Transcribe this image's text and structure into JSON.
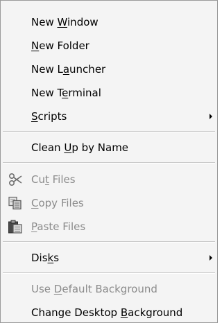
{
  "menu": {
    "items": [
      {
        "label_before": "New ",
        "mnemonic": "W",
        "label_after": "indow",
        "enabled": true,
        "submenu": false
      },
      {
        "label_before": "",
        "mnemonic": "N",
        "label_after": "ew Folder",
        "enabled": true,
        "submenu": false
      },
      {
        "label_before": "New L",
        "mnemonic": "a",
        "label_after": "uncher",
        "enabled": true,
        "submenu": false
      },
      {
        "label_before": "New T",
        "mnemonic": "e",
        "label_after": "rminal",
        "enabled": true,
        "submenu": false
      },
      {
        "label_before": "",
        "mnemonic": "S",
        "label_after": "cripts",
        "enabled": true,
        "submenu": true
      },
      {
        "label_before": "Clean ",
        "mnemonic": "U",
        "label_after": "p by Name",
        "enabled": true,
        "submenu": false
      },
      {
        "label_before": "Cu",
        "mnemonic": "t",
        "label_after": " Files",
        "enabled": false,
        "submenu": false,
        "icon": "scissors-icon"
      },
      {
        "label_before": "",
        "mnemonic": "C",
        "label_after": "opy Files",
        "enabled": false,
        "submenu": false,
        "icon": "copy-icon"
      },
      {
        "label_before": "",
        "mnemonic": "P",
        "label_after": "aste Files",
        "enabled": false,
        "submenu": false,
        "icon": "clipboard-icon"
      },
      {
        "label_before": "Dis",
        "mnemonic": "k",
        "label_after": "s",
        "enabled": true,
        "submenu": true
      },
      {
        "label_before": "Use ",
        "mnemonic": "D",
        "label_after": "efault Background",
        "enabled": false,
        "submenu": false
      },
      {
        "label_before": "Change Desktop ",
        "mnemonic": "B",
        "label_after": "ackground",
        "enabled": true,
        "submenu": false
      }
    ]
  },
  "colors": {
    "menu_background": "#f4f4f4",
    "disabled_text": "#8b8b8b",
    "separator": "#c8c8c8"
  }
}
